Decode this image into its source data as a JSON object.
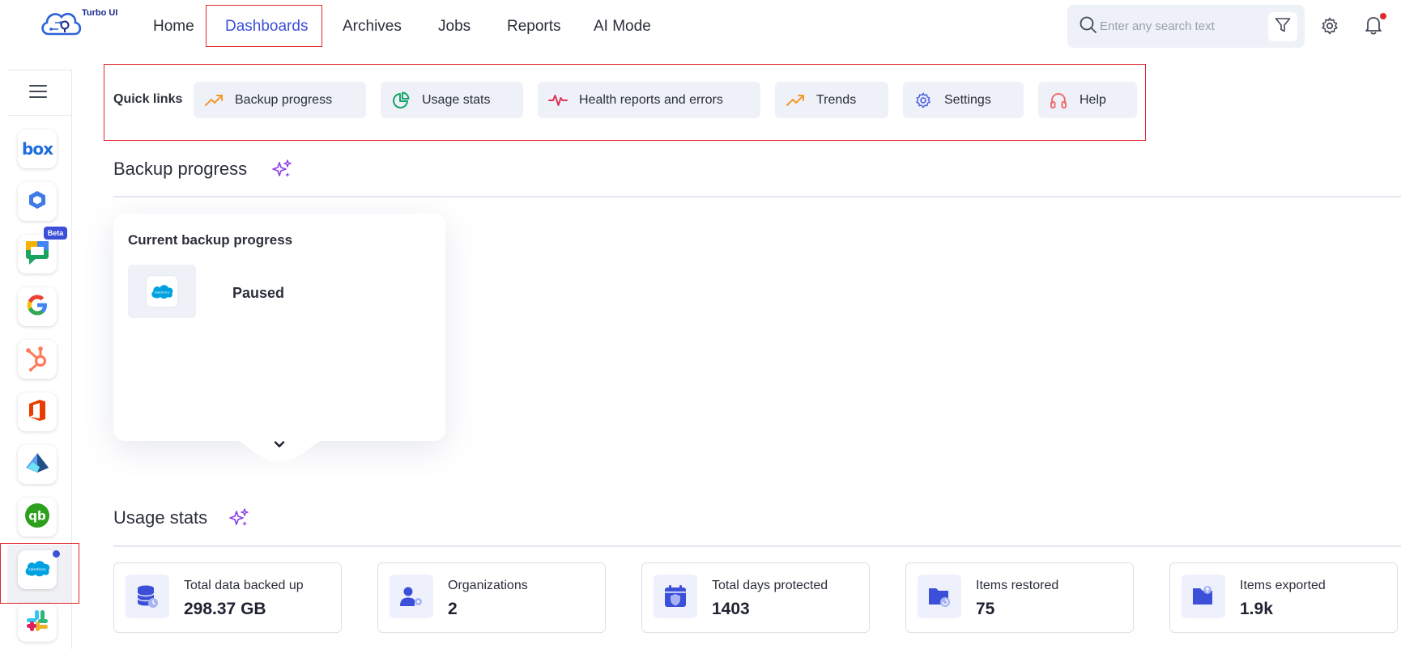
{
  "app": {
    "name": "Turbo UI"
  },
  "nav": {
    "items": [
      "Home",
      "Dashboards",
      "Archives",
      "Jobs",
      "Reports",
      "AI Mode"
    ],
    "active": "Dashboards"
  },
  "search": {
    "placeholder": "Enter any search text"
  },
  "icons": {
    "filter": "filter-icon",
    "settings": "gear-icon",
    "notifications": "bell-icon",
    "menu": "hamburger-icon"
  },
  "sidebar": {
    "apps": [
      {
        "name": "box",
        "icon": "box-logo"
      },
      {
        "name": "hexagon",
        "icon": "hexagon-logo"
      },
      {
        "name": "google-chat",
        "icon": "google-chat-logo",
        "badge": "Beta"
      },
      {
        "name": "google",
        "icon": "google-logo"
      },
      {
        "name": "hubspot",
        "icon": "hubspot-logo"
      },
      {
        "name": "office",
        "icon": "office-logo"
      },
      {
        "name": "azure-ad",
        "icon": "azure-logo"
      },
      {
        "name": "quickbooks",
        "icon": "quickbooks-logo"
      },
      {
        "name": "salesforce",
        "icon": "salesforce-logo",
        "selected": true
      },
      {
        "name": "slack",
        "icon": "slack-logo"
      }
    ]
  },
  "quick_links": {
    "label": "Quick links",
    "items": [
      {
        "label": "Backup progress",
        "icon": "trend-up-icon",
        "color": "#f2992e"
      },
      {
        "label": "Usage stats",
        "icon": "pie-chart-icon",
        "color": "#16a36a"
      },
      {
        "label": "Health reports and errors",
        "icon": "pulse-icon",
        "color": "#e0325a"
      },
      {
        "label": "Trends",
        "icon": "trend-up-icon",
        "color": "#f2992e"
      },
      {
        "label": "Settings",
        "icon": "gear-icon",
        "color": "#4b5fe0"
      },
      {
        "label": "Help",
        "icon": "headphones-icon",
        "color": "#ef6f6f"
      }
    ]
  },
  "backup_progress": {
    "title": "Backup progress",
    "card_title": "Current backup progress",
    "status": "Paused",
    "app_icon": "salesforce-logo"
  },
  "usage_stats": {
    "title": "Usage stats",
    "items": [
      {
        "label": "Total data backed up",
        "value": "298.37 GB",
        "icon": "database-icon"
      },
      {
        "label": "Organizations",
        "value": "2",
        "icon": "users-gear-icon"
      },
      {
        "label": "Total days protected",
        "value": "1403",
        "icon": "calendar-shield-icon"
      },
      {
        "label": "Items restored",
        "value": "75",
        "icon": "folder-restore-icon"
      },
      {
        "label": "Items exported",
        "value": "1.9k",
        "icon": "folder-export-icon"
      }
    ]
  },
  "colors": {
    "accent": "#3c4fd8",
    "highlight_frame": "#e0282e",
    "sparkle": "#8a3ee8"
  }
}
